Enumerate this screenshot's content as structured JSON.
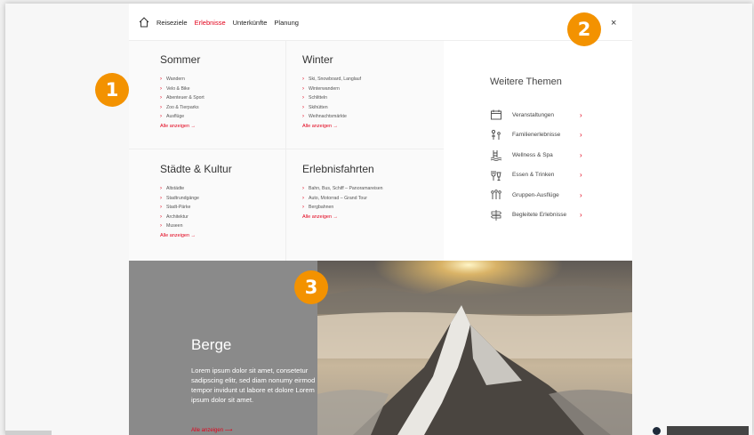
{
  "nav": {
    "items": [
      {
        "label": "Reiseziele",
        "active": false
      },
      {
        "label": "Erlebnisse",
        "active": true
      },
      {
        "label": "Unterkünfte",
        "active": false
      },
      {
        "label": "Planung",
        "active": false
      }
    ],
    "close": "×"
  },
  "columns": {
    "sommer": {
      "title": "Sommer",
      "items": [
        "Wandern",
        "Velo & Bike",
        "Abenteuer & Sport",
        "Zoo & Tierparks",
        "Ausflüge"
      ],
      "all": "Alle anzeigen →"
    },
    "winter": {
      "title": "Winter",
      "items": [
        "Ski, Snowboard, Langlauf",
        "Winterwandern",
        "Schlitteln",
        "Skihütten",
        "Weihnachtsmärkte"
      ],
      "all": "Alle anzeigen →"
    },
    "staedte": {
      "title": "Städte & Kultur",
      "items": [
        "Altstädte",
        "Stadtrundgänge",
        "Stadt-Pärke",
        "Architektur",
        "Museen"
      ],
      "all": "Alle anzeigen →"
    },
    "fahrten": {
      "title": "Erlebnisfahrten",
      "items": [
        "Bahn, Bus, Schiff – Panoramareisen",
        "Auto, Motorrad – Grand Tour",
        "Bergbahnen"
      ],
      "all": "Alle anzeigen →"
    }
  },
  "themes": {
    "title": "Weitere Themen",
    "items": [
      {
        "label": "Veranstaltungen",
        "icon": "calendar-icon"
      },
      {
        "label": "Familienerlebnisse",
        "icon": "family-icon"
      },
      {
        "label": "Wellness & Spa",
        "icon": "spa-icon"
      },
      {
        "label": "Essen & Trinken",
        "icon": "dining-icon"
      },
      {
        "label": "Gruppen-Ausflüge",
        "icon": "group-icon"
      },
      {
        "label": "Begleitete Erlebnisse",
        "icon": "signpost-icon"
      }
    ],
    "arrow": "›"
  },
  "hero": {
    "title": "Berge",
    "text": "Lorem ipsum dolor sit amet, consetetur sadipscing elitr, sed diam nonumy eirmod tempor invidunt ut labore et dolore Lorem ipsum dolor sit amet.",
    "link": "Alle anzeigen ⟶"
  },
  "badges": [
    "1",
    "2",
    "3"
  ],
  "colors": {
    "accent": "#e2001a",
    "badge": "#f39200"
  }
}
